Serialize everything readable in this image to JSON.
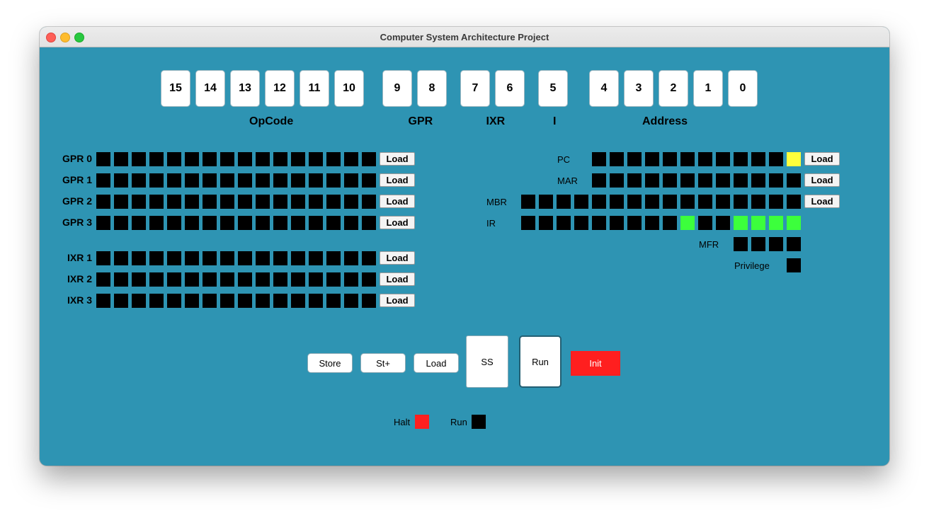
{
  "window": {
    "title": "Computer System Architecture Project"
  },
  "switches": [
    {
      "label": "15"
    },
    {
      "label": "14"
    },
    {
      "label": "13"
    },
    {
      "label": "12"
    },
    {
      "label": "11"
    },
    {
      "label": "10"
    },
    {
      "label": "9"
    },
    {
      "label": "8"
    },
    {
      "label": "7"
    },
    {
      "label": "6"
    },
    {
      "label": "5"
    },
    {
      "label": "4"
    },
    {
      "label": "3"
    },
    {
      "label": "2"
    },
    {
      "label": "1"
    },
    {
      "label": "0"
    }
  ],
  "switch_groups": [
    {
      "label": "OpCode"
    },
    {
      "label": "GPR"
    },
    {
      "label": "IXR"
    },
    {
      "label": "I"
    },
    {
      "label": "Address"
    }
  ],
  "registers_left": [
    {
      "label": "GPR 0",
      "bits": "0000000000000000",
      "load": "Load"
    },
    {
      "label": "GPR 1",
      "bits": "0000000000000000",
      "load": "Load"
    },
    {
      "label": "GPR 2",
      "bits": "0000000000000000",
      "load": "Load"
    },
    {
      "label": "GPR 3",
      "bits": "0000000000000000",
      "load": "Load"
    },
    {
      "label": "IXR 1",
      "bits": "0000000000000000",
      "load": "Load"
    },
    {
      "label": "IXR 2",
      "bits": "0000000000000000",
      "load": "Load"
    },
    {
      "label": "IXR 3",
      "bits": "0000000000000000",
      "load": "Load"
    }
  ],
  "registers_right": [
    {
      "label": "PC",
      "bits": "000000000001",
      "on_color": "#ffff3c",
      "load": "Load"
    },
    {
      "label": "MAR",
      "bits": "000000000000",
      "on_color": "#ffff3c",
      "load": "Load"
    },
    {
      "label": "MBR",
      "bits": "0000000000000000",
      "on_color": "#ffff3c",
      "load": "Load"
    },
    {
      "label": "IR",
      "bits": "0000000001001111",
      "on_color": "#3cff3c"
    },
    {
      "label": "MFR",
      "bits": "0000",
      "on_color": "#3cff3c"
    },
    {
      "label": "Privilege",
      "bits": "0",
      "on_color": "#3cff3c"
    }
  ],
  "controls": {
    "store": "Store",
    "store_plus": "St+",
    "load": "Load",
    "ss": "SS",
    "run": "Run",
    "init": "Init"
  },
  "indicators": [
    {
      "label": "Halt",
      "color": "#ff1f1f"
    },
    {
      "label": "Run",
      "color": "#000000"
    }
  ],
  "colors": {
    "panel": "#2e94b3",
    "off": "#000000",
    "init": "#ff1f1f"
  }
}
